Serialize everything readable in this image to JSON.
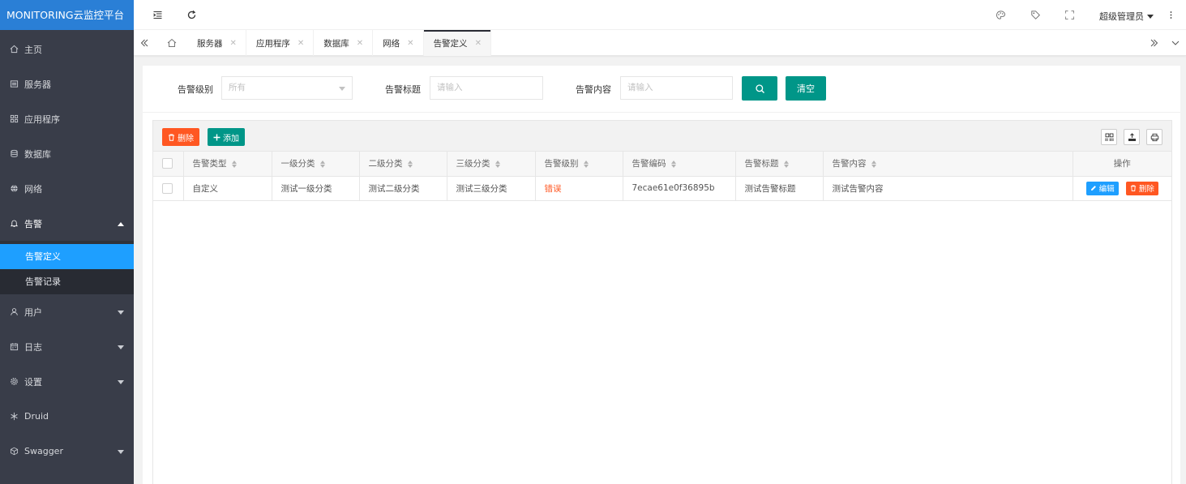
{
  "app": {
    "title": "MONITORING云监控平台"
  },
  "sidebar": {
    "items": [
      {
        "label": "主页",
        "icon": "home-icon"
      },
      {
        "label": "服务器",
        "icon": "server-icon"
      },
      {
        "label": "应用程序",
        "icon": "apps-icon"
      },
      {
        "label": "数据库",
        "icon": "database-icon"
      },
      {
        "label": "网络",
        "icon": "globe-icon"
      },
      {
        "label": "告警",
        "icon": "bell-icon",
        "expanded": true
      },
      {
        "label": "用户",
        "icon": "user-icon"
      },
      {
        "label": "日志",
        "icon": "calendar-icon"
      },
      {
        "label": "设置",
        "icon": "gear-icon"
      },
      {
        "label": "Druid",
        "icon": "snowflake-icon"
      },
      {
        "label": "Swagger",
        "icon": "cube-icon"
      }
    ],
    "alarm_sub": [
      {
        "label": "告警定义",
        "active": true
      },
      {
        "label": "告警记录",
        "active": false
      }
    ]
  },
  "header": {
    "user_name": "超级管理员"
  },
  "tabs": [
    {
      "label": "服务器"
    },
    {
      "label": "应用程序"
    },
    {
      "label": "数据库"
    },
    {
      "label": "网络"
    },
    {
      "label": "告警定义",
      "active": true
    }
  ],
  "search": {
    "level_label": "告警级别",
    "level_value": "所有",
    "title_label": "告警标题",
    "title_placeholder": "请输入",
    "content_label": "告警内容",
    "content_placeholder": "请输入",
    "clear_label": "清空"
  },
  "toolbar": {
    "delete_label": "删除",
    "add_label": "添加"
  },
  "table": {
    "columns": [
      "告警类型",
      "一级分类",
      "二级分类",
      "三级分类",
      "告警级别",
      "告警编码",
      "告警标题",
      "告警内容",
      "操作"
    ],
    "rows": [
      {
        "type": "自定义",
        "cat1": "测试一级分类",
        "cat2": "测试二级分类",
        "cat3": "测试三级分类",
        "level": "错误",
        "code": "7ecae61e0f36895b",
        "title": "测试告警标题",
        "content": "测试告警内容",
        "edit_label": "编辑",
        "delete_label": "删除"
      }
    ]
  },
  "colors": {
    "accent": "#009688",
    "danger": "#ff5722",
    "primary": "#1e9fff",
    "logo_bg": "#2a7fd6",
    "sidebar_bg": "#393d49"
  }
}
